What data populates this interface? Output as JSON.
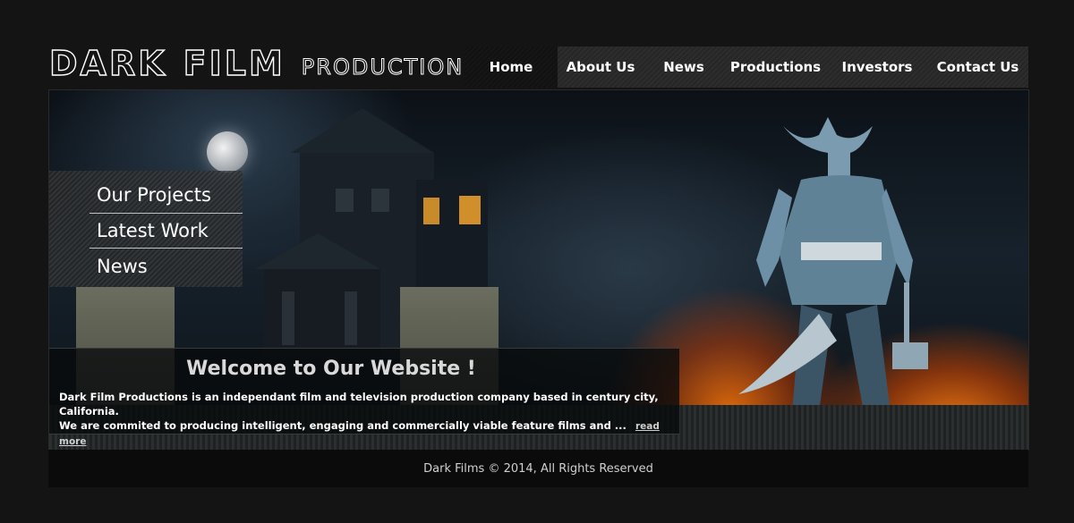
{
  "brand": {
    "word1": "Dark",
    "word2": "Film",
    "word3": "Productions"
  },
  "nav": {
    "items": [
      {
        "label": "Home",
        "active": true
      },
      {
        "label": "About Us",
        "active": false
      },
      {
        "label": "News",
        "active": false
      },
      {
        "label": "Productions",
        "active": false
      },
      {
        "label": "Investors",
        "active": false
      },
      {
        "label": "Contact Us",
        "active": false
      }
    ]
  },
  "side_menu": {
    "items": [
      "Our Projects",
      "Latest Work",
      "News"
    ]
  },
  "welcome": {
    "title": "Welcome to Our Website !",
    "line1": "Dark Film Productions is an independant film and television production company based in century city, California.",
    "line2": "We are commited to producing intelligent, engaging and commercially viable feature films and ...",
    "read_more": "read more"
  },
  "footer": {
    "text": "Dark Films © 2014, All Rights Reserved"
  },
  "colors": {
    "background": "#141414",
    "nav_bg": "#2a2a2a",
    "nav_active": "#141414",
    "text": "#ffffff",
    "fire": "#ff8214"
  }
}
